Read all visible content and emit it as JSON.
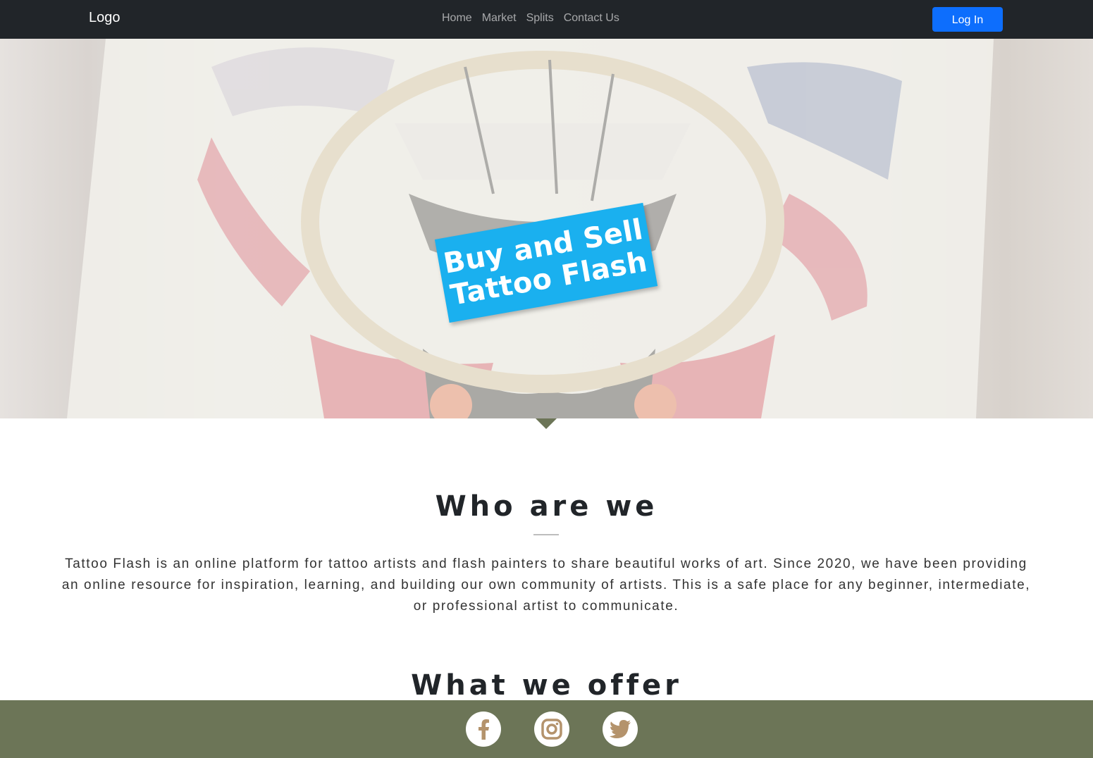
{
  "navbar": {
    "brand": "Logo",
    "links": [
      "Home",
      "Market",
      "Splits",
      "Contact Us"
    ],
    "login_label": "Log In"
  },
  "hero": {
    "line1": "Buy and Sell",
    "line2": "Tattoo Flash"
  },
  "about": {
    "title": "Who are we",
    "text": "Tattoo Flash is an online platform for tattoo artists and flash painters to share beautiful works of art. Since 2020, we have been providing an online resource for inspiration, learning, and building our own community of artists. This is a safe place for any beginner, intermediate, or professional artist to communicate."
  },
  "offer": {
    "title": "What we offer"
  },
  "footer": {
    "social": [
      "facebook-icon",
      "instagram-icon",
      "twitter-icon"
    ]
  },
  "colors": {
    "navbar_bg": "#212529",
    "primary": "#0d6efd",
    "banner": "#1ab0ef",
    "footer_bg": "#6c7557",
    "icon_color": "#b4936c"
  }
}
